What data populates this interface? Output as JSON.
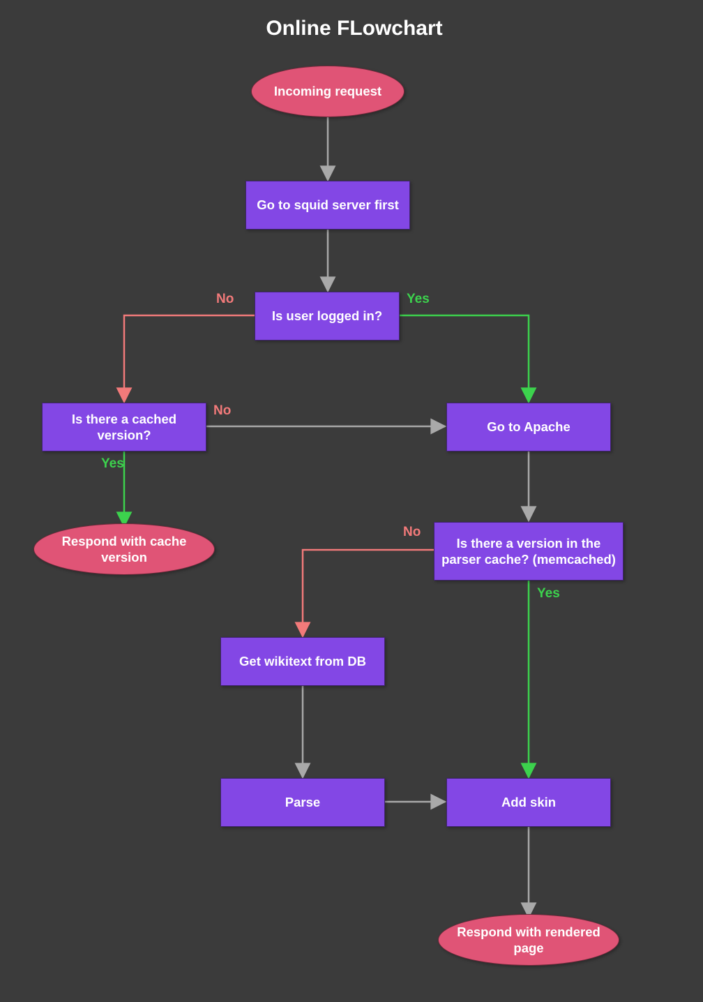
{
  "title": "Online FLowchart",
  "labels": {
    "yes": "Yes",
    "no": "No"
  },
  "nodes": {
    "incoming": {
      "text": "Incoming request",
      "type": "terminator"
    },
    "squid": {
      "text": "Go to squid server first",
      "type": "process"
    },
    "loggedin": {
      "text": "Is user logged in?",
      "type": "process"
    },
    "cached": {
      "text": "Is there a cached version?",
      "type": "process"
    },
    "apache": {
      "text": "Go to Apache",
      "type": "process"
    },
    "respond_cache": {
      "text": "Respond with cache version",
      "type": "terminator"
    },
    "parser_cache": {
      "text": "Is there a version in the parser cache? (memcached)",
      "type": "process"
    },
    "getwiki": {
      "text": "Get wikitext from DB",
      "type": "process"
    },
    "parse": {
      "text": "Parse",
      "type": "process"
    },
    "addskin": {
      "text": "Add skin",
      "type": "process"
    },
    "respond_page": {
      "text": "Respond with rendered page",
      "type": "terminator"
    }
  },
  "edges": [
    {
      "from": "incoming",
      "to": "squid",
      "label": null,
      "color": "gray"
    },
    {
      "from": "squid",
      "to": "loggedin",
      "label": null,
      "color": "gray"
    },
    {
      "from": "loggedin",
      "to": "cached",
      "label": "no",
      "color": "red"
    },
    {
      "from": "loggedin",
      "to": "apache",
      "label": "yes",
      "color": "green"
    },
    {
      "from": "cached",
      "to": "apache",
      "label": "no",
      "color": "gray"
    },
    {
      "from": "cached",
      "to": "respond_cache",
      "label": "yes",
      "color": "green"
    },
    {
      "from": "apache",
      "to": "parser_cache",
      "label": null,
      "color": "gray"
    },
    {
      "from": "parser_cache",
      "to": "getwiki",
      "label": "no",
      "color": "red"
    },
    {
      "from": "parser_cache",
      "to": "addskin",
      "label": "yes",
      "color": "green"
    },
    {
      "from": "getwiki",
      "to": "parse",
      "label": null,
      "color": "gray"
    },
    {
      "from": "parse",
      "to": "addskin",
      "label": null,
      "color": "gray"
    },
    {
      "from": "addskin",
      "to": "respond_page",
      "label": null,
      "color": "gray"
    }
  ],
  "colors": {
    "background": "#3b3b3b",
    "process": "#8347e5",
    "terminator": "#e05476",
    "arrow_gray": "#a9a9a9",
    "arrow_red": "#f27a7a",
    "arrow_green": "#3cd24d"
  }
}
